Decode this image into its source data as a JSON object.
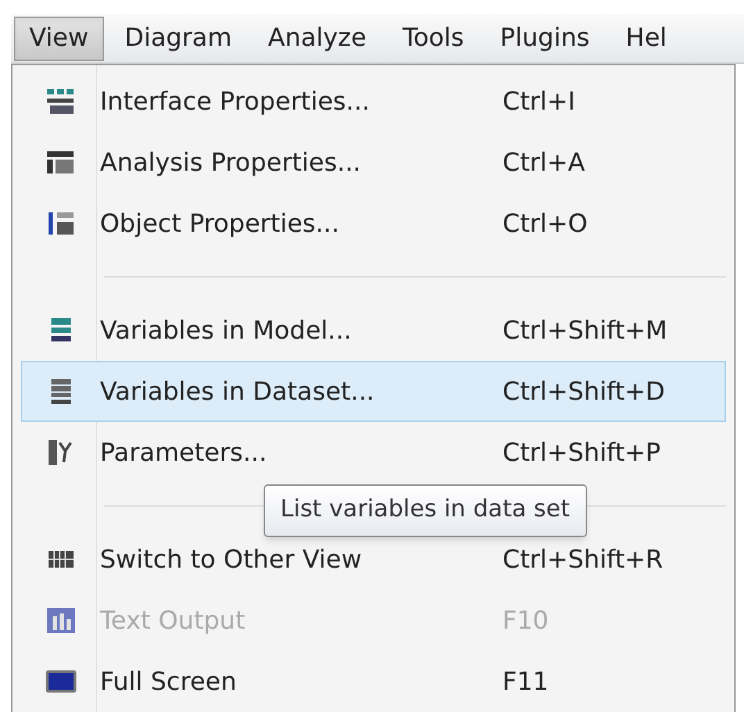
{
  "menu_bar": [
    {
      "label": "View",
      "selected": true
    },
    {
      "label": "Diagram",
      "selected": false
    },
    {
      "label": "Analyze",
      "selected": false
    },
    {
      "label": "Tools",
      "selected": false
    },
    {
      "label": "Plugins",
      "selected": false
    },
    {
      "label": "Hel",
      "selected": false
    }
  ],
  "menu": [
    {
      "kind": "item",
      "label": "Interface Properties...",
      "shortcut": "Ctrl+I",
      "selected": false,
      "disabled": false
    },
    {
      "kind": "item",
      "label": "Analysis Properties...",
      "shortcut": "Ctrl+A",
      "selected": false,
      "disabled": false
    },
    {
      "kind": "item",
      "label": "Object Properties...",
      "shortcut": "Ctrl+O",
      "selected": false,
      "disabled": false
    },
    {
      "kind": "separator"
    },
    {
      "kind": "item",
      "label": "Variables in Model...",
      "shortcut": "Ctrl+Shift+M",
      "selected": false,
      "disabled": false
    },
    {
      "kind": "item",
      "label": "Variables in Dataset...",
      "shortcut": "Ctrl+Shift+D",
      "selected": true,
      "disabled": false
    },
    {
      "kind": "item",
      "label": "Parameters...",
      "shortcut": "Ctrl+Shift+P",
      "selected": false,
      "disabled": false
    },
    {
      "kind": "separator"
    },
    {
      "kind": "item",
      "label": "Switch to Other View",
      "shortcut": "Ctrl+Shift+R",
      "selected": false,
      "disabled": false
    },
    {
      "kind": "item",
      "label": "Text Output",
      "shortcut": "F10",
      "selected": false,
      "disabled": true
    },
    {
      "kind": "item",
      "label": "Full Screen",
      "shortcut": "F11",
      "selected": false,
      "disabled": false
    }
  ],
  "tooltip": {
    "text": "List variables in data set"
  }
}
